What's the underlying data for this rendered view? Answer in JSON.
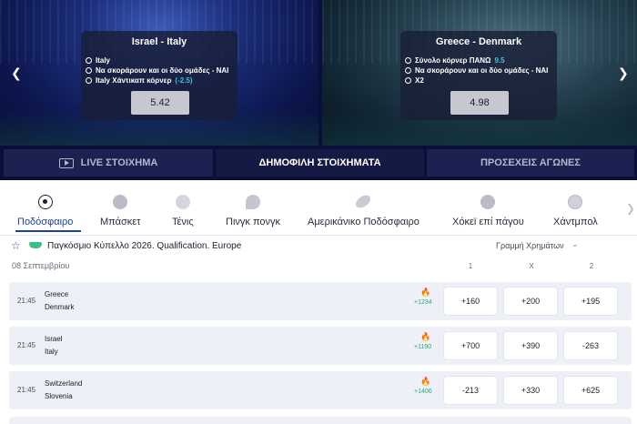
{
  "promos": [
    {
      "title": "Israel  -  Italy",
      "selections": [
        {
          "text": "Italy",
          "highlight": ""
        },
        {
          "text": "Να σκοράρουν και οι δύο ομάδες - ΝΑΙ",
          "highlight": ""
        },
        {
          "text": "Italy Χάντικαπ κόρνερ",
          "highlight": "(-2.5)"
        }
      ],
      "odds": "5.42"
    },
    {
      "title": "Greece  -  Denmark",
      "selections": [
        {
          "text": "Σύνολο κόρνερ ΠΑΝΩ",
          "highlight": "9.5"
        },
        {
          "text": "Να σκοράρουν και οι δύο ομάδες - ΝΑΙ",
          "highlight": ""
        },
        {
          "text": "X2",
          "highlight": ""
        }
      ],
      "odds": "4.98"
    }
  ],
  "carousel": {
    "prev_icon": "chevron-left-icon",
    "next_icon": "chevron-right-icon"
  },
  "nav_tabs": [
    {
      "label": "LIVE ΣΤΟΙΧΗΜΑ",
      "icon": "live-play-icon"
    },
    {
      "label": "ΔΗΜΟΦΙΛΗ ΣΤΟΙΧΗΜΑΤΑ"
    },
    {
      "label": "ΠΡΟΣΕΧΕΙΣ ΑΓΩΝΕΣ"
    }
  ],
  "sports": [
    {
      "label": "Ποδόσφαιρο",
      "icon": "football-icon",
      "active": true
    },
    {
      "label": "Μπάσκετ",
      "icon": "basketball-icon"
    },
    {
      "label": "Τένις",
      "icon": "tennis-icon"
    },
    {
      "label": "Πινγκ πονγκ",
      "icon": "ping-pong-icon"
    },
    {
      "label": "Αμερικάνικο Ποδόσφαιρο",
      "icon": "american-football-icon"
    },
    {
      "label": "Χόκεϊ επί πάγου",
      "icon": "ice-hockey-icon"
    },
    {
      "label": "Χάντμπολ",
      "icon": "handball-icon"
    }
  ],
  "league": {
    "name": "Παγκόσμιο Κύπελλο 2026. Qualification. Europe",
    "market": "Γραμμή Χρημάτων",
    "date": "08 Σεπτεμβρίου",
    "columns": [
      "1",
      "X",
      "2"
    ]
  },
  "matches": [
    {
      "time": "21:45",
      "home": "Greece",
      "away": "Denmark",
      "popularity": "+1234",
      "odds": [
        "+160",
        "+200",
        "+195"
      ]
    },
    {
      "time": "21:45",
      "home": "Israel",
      "away": "Italy",
      "popularity": "+1190",
      "odds": [
        "+700",
        "+390",
        "-263"
      ]
    },
    {
      "time": "21:45",
      "home": "Switzerland",
      "away": "Slovenia",
      "popularity": "+1406",
      "odds": [
        "-213",
        "+330",
        "+625"
      ]
    }
  ],
  "colors": {
    "accent": "#1c3fa8",
    "navbar": "#0a0f3a",
    "row_bg": "#eef0f8",
    "popularity": "#2aa876"
  }
}
